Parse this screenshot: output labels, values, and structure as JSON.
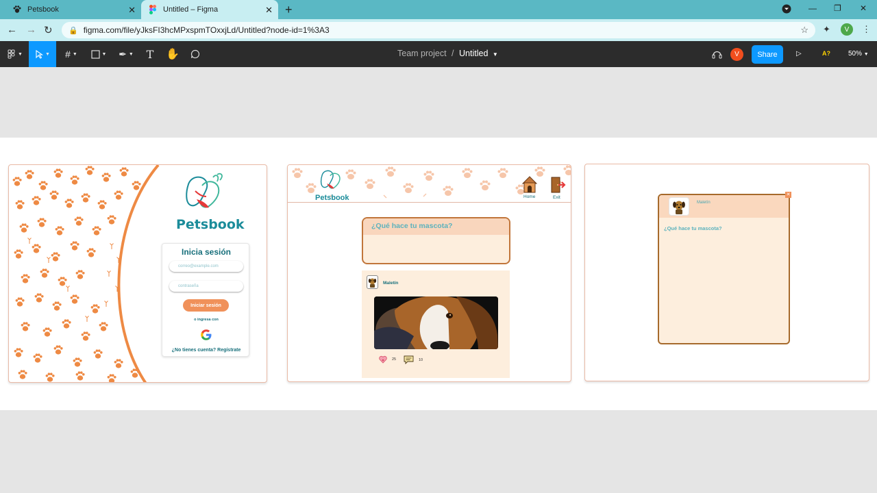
{
  "browser": {
    "tabs": [
      {
        "label": "Petsbook",
        "icon": "petsbook-favicon"
      },
      {
        "label": "Untitled – Figma",
        "icon": "figma-favicon"
      }
    ],
    "url": "figma.com/file/yJksFI3hcMPxspmTOxxjLd/Untitled?node-id=1%3A3",
    "profile_initial": "V"
  },
  "figma": {
    "project": "Team project",
    "separator": "/",
    "file_name": "Untitled",
    "user_initial": "V",
    "share_label": "Share",
    "spell_label": "A?",
    "zoom": "50%"
  },
  "frame1": {
    "brand": "Petsbook",
    "login_title": "Inicia sesión",
    "email_placeholder": "correo@example.com",
    "password_placeholder": "contraseña",
    "login_button": "Iniciar sesión",
    "alt_login": "o ingresa con",
    "register": "¿No tienes cuenta? Regístrate"
  },
  "frame2": {
    "brand": "Petsbook",
    "home_label": "Home",
    "exit_label": "Exit",
    "compose_placeholder": "¿Qué hace tu mascota?",
    "post": {
      "author": "Maletín",
      "likes": "25",
      "comments": "10"
    }
  },
  "frame3": {
    "author": "Maletín",
    "prompt": "¿Qué hace tu mascota?"
  },
  "colors": {
    "accent_orange": "#f0915a",
    "teal_brand": "#1b8c9a",
    "figma_blue": "#0d99ff",
    "chrome_teal": "#5ab8c4"
  }
}
